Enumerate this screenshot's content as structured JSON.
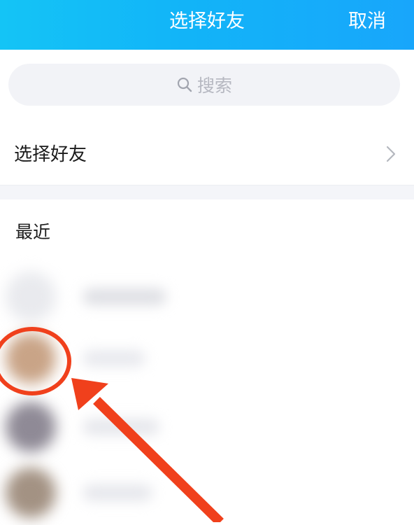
{
  "header": {
    "title": "选择好友",
    "cancel_label": "取消"
  },
  "search": {
    "icon": "search-icon",
    "placeholder": "搜索"
  },
  "select_friends_row": {
    "label": "选择好友",
    "icon": "chevron-right-icon"
  },
  "recent": {
    "section_label": "最近",
    "contacts": [
      {
        "avatar_color": "#e9eaee"
      },
      {
        "avatar_color": "#c9a487"
      },
      {
        "avatar_color": "#8f8a96"
      },
      {
        "avatar_color": "#a39283"
      }
    ]
  },
  "annotation": {
    "color": "#f0401c"
  }
}
